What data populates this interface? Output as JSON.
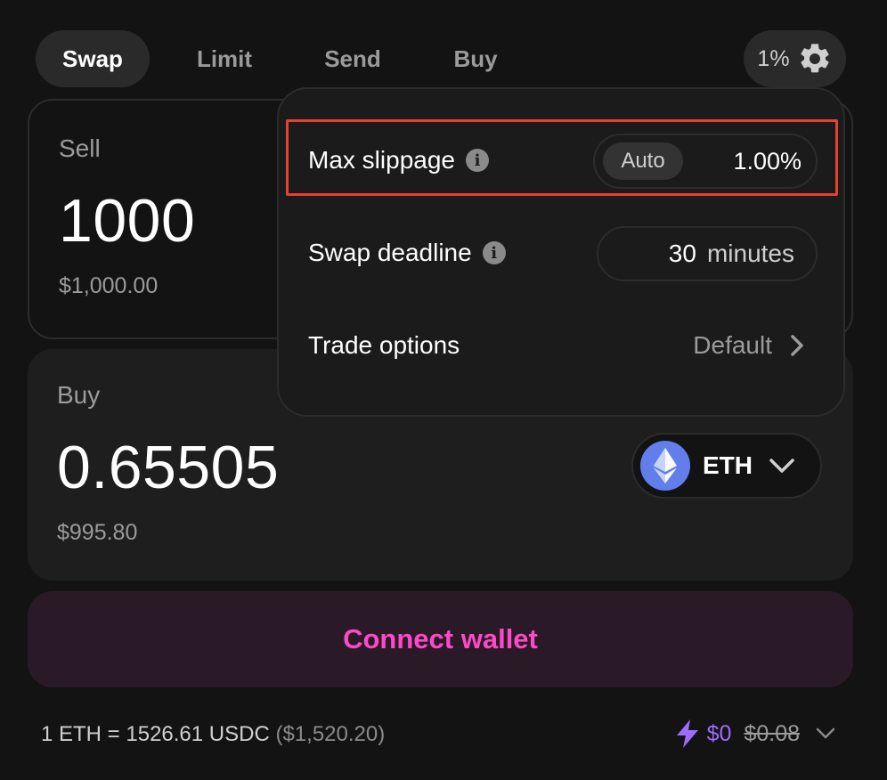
{
  "tabs": [
    {
      "label": "Swap",
      "active": true
    },
    {
      "label": "Limit",
      "active": false
    },
    {
      "label": "Send",
      "active": false
    },
    {
      "label": "Buy",
      "active": false
    }
  ],
  "settings_button": {
    "label": "1%",
    "icon": "gear-icon"
  },
  "sell": {
    "label": "Sell",
    "amount": "1000",
    "usd_value": "$1,000.00"
  },
  "buy": {
    "label": "Buy",
    "amount": "0.65505",
    "usd_value": "$995.80",
    "token": {
      "symbol": "ETH",
      "icon": "eth-logo-icon",
      "color": "#627EEA"
    }
  },
  "connect_wallet": {
    "label": "Connect wallet",
    "color": "#FC49C5"
  },
  "footer": {
    "rate": "1 ETH = 1526.61 USDC",
    "rate_usd": "($1,520.20)",
    "gas_fee": "$0",
    "gas_fee_original": "$0.08",
    "gas_icon": "lightning-icon"
  },
  "settings_dropdown": {
    "max_slippage": {
      "label": "Max slippage",
      "auto_label": "Auto",
      "value": "1.00%"
    },
    "swap_deadline": {
      "label": "Swap deadline",
      "value": "30",
      "unit": "minutes"
    },
    "trade_options": {
      "label": "Trade options",
      "value": "Default"
    }
  },
  "colors": {
    "background": "#131313",
    "panel": "#1E1E1E",
    "highlight_border": "#E8412D",
    "gas_accent": "#9B6CFF"
  }
}
